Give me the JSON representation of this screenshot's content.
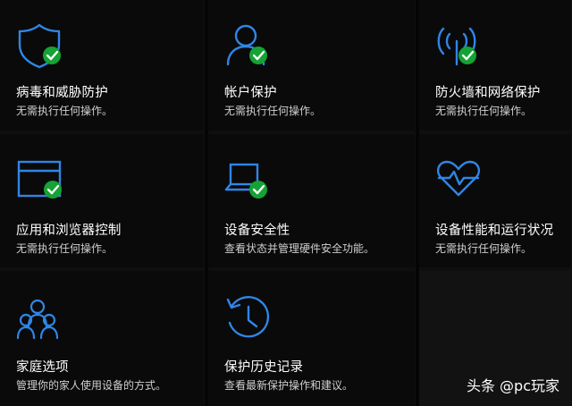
{
  "colors": {
    "accent": "#2f86e6",
    "check": "#14a334",
    "background": "#0a0a0a"
  },
  "tiles": [
    {
      "title": "病毒和威胁防护",
      "subtitle": "无需执行任何操作。",
      "icon": "shield-icon",
      "status": "ok"
    },
    {
      "title": "帐户保护",
      "subtitle": "无需执行任何操作。",
      "icon": "person-icon",
      "status": "ok"
    },
    {
      "title": "防火墙和网络保护",
      "subtitle": "无需执行任何操作。",
      "icon": "antenna-icon",
      "status": "ok"
    },
    {
      "title": "应用和浏览器控制",
      "subtitle": "无需执行任何操作。",
      "icon": "browser-window-icon",
      "status": "ok"
    },
    {
      "title": "设备安全性",
      "subtitle": "查看状态并管理硬件安全功能。",
      "icon": "laptop-icon",
      "status": "ok"
    },
    {
      "title": "设备性能和运行状况",
      "subtitle": "无需执行任何操作。",
      "icon": "heart-pulse-icon",
      "status": "none"
    },
    {
      "title": "家庭选项",
      "subtitle": "管理你的家人使用设备的方式。",
      "icon": "family-icon",
      "status": "none"
    },
    {
      "title": "保护历史记录",
      "subtitle": "查看最新保护操作和建议。",
      "icon": "history-clock-icon",
      "status": "none"
    }
  ],
  "watermark": "头条 @pc玩家"
}
